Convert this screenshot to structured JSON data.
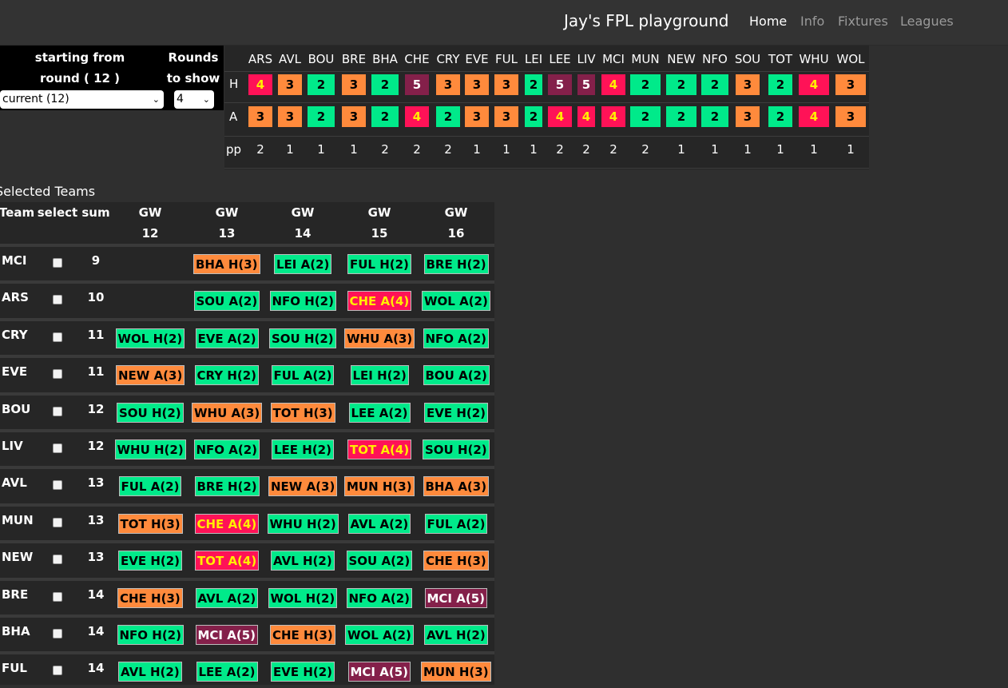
{
  "nav": {
    "brand": "Jay's FPL playground",
    "links": [
      "Home",
      "Info",
      "Fixtures",
      "Leagues"
    ]
  },
  "controls": {
    "start_label_line1": "starting from",
    "start_label_line2": "round ( 12 )",
    "rounds_label_line1": "Rounds",
    "rounds_label_line2": "to show",
    "round_select_value": "current (12)",
    "show_select_value": "4"
  },
  "difficulty": {
    "teams": [
      "ARS",
      "AVL",
      "BOU",
      "BRE",
      "BHA",
      "CHE",
      "CRY",
      "EVE",
      "FUL",
      "LEI",
      "LEE",
      "LIV",
      "MCI",
      "MUN",
      "NEW",
      "NFO",
      "SOU",
      "TOT",
      "WHU",
      "WOL"
    ],
    "home_label": "H",
    "away_label": "A",
    "pp_label": "pp",
    "home": [
      4,
      3,
      2,
      3,
      2,
      5,
      3,
      3,
      3,
      2,
      5,
      5,
      4,
      2,
      2,
      2,
      3,
      2,
      4,
      3
    ],
    "away": [
      3,
      3,
      2,
      3,
      2,
      4,
      2,
      3,
      3,
      2,
      4,
      4,
      4,
      2,
      2,
      2,
      3,
      2,
      4,
      3
    ],
    "pp": [
      2,
      1,
      1,
      1,
      2,
      2,
      2,
      1,
      1,
      1,
      2,
      2,
      2,
      2,
      1,
      1,
      1,
      1,
      1,
      1
    ]
  },
  "selected": {
    "title": "Selected Teams",
    "headers": {
      "team": "Team",
      "select": "select",
      "sum": "sum",
      "gw_word": "GW",
      "gws": [
        "12",
        "13",
        "14",
        "15",
        "16"
      ]
    },
    "rows": [
      {
        "team": "MCI",
        "sum": "9",
        "fixtures": [
          null,
          {
            "t": "BHA H(3)",
            "d": 3
          },
          {
            "t": "LEI A(2)",
            "d": 2
          },
          {
            "t": "FUL H(2)",
            "d": 2
          },
          {
            "t": "BRE H(2)",
            "d": 2
          }
        ]
      },
      {
        "team": "ARS",
        "sum": "10",
        "fixtures": [
          null,
          {
            "t": "SOU A(2)",
            "d": 2
          },
          {
            "t": "NFO H(2)",
            "d": 2
          },
          {
            "t": "CHE A(4)",
            "d": 4
          },
          {
            "t": "WOL A(2)",
            "d": 2
          }
        ]
      },
      {
        "team": "CRY",
        "sum": "11",
        "fixtures": [
          {
            "t": "WOL H(2)",
            "d": 2
          },
          {
            "t": "EVE A(2)",
            "d": 2
          },
          {
            "t": "SOU H(2)",
            "d": 2
          },
          {
            "t": "WHU A(3)",
            "d": 3
          },
          {
            "t": "NFO A(2)",
            "d": 2
          }
        ]
      },
      {
        "team": "EVE",
        "sum": "11",
        "fixtures": [
          {
            "t": "NEW A(3)",
            "d": 3
          },
          {
            "t": "CRY H(2)",
            "d": 2
          },
          {
            "t": "FUL A(2)",
            "d": 2
          },
          {
            "t": "LEI H(2)",
            "d": 2
          },
          {
            "t": "BOU A(2)",
            "d": 2
          }
        ]
      },
      {
        "team": "BOU",
        "sum": "12",
        "fixtures": [
          {
            "t": "SOU H(2)",
            "d": 2
          },
          {
            "t": "WHU A(3)",
            "d": 3
          },
          {
            "t": "TOT H(3)",
            "d": 3
          },
          {
            "t": "LEE A(2)",
            "d": 2
          },
          {
            "t": "EVE H(2)",
            "d": 2
          }
        ]
      },
      {
        "team": "LIV",
        "sum": "12",
        "fixtures": [
          {
            "t": "WHU H(2)",
            "d": 2
          },
          {
            "t": "NFO A(2)",
            "d": 2
          },
          {
            "t": "LEE H(2)",
            "d": 2
          },
          {
            "t": "TOT A(4)",
            "d": 4
          },
          {
            "t": "SOU H(2)",
            "d": 2
          }
        ]
      },
      {
        "team": "AVL",
        "sum": "13",
        "fixtures": [
          {
            "t": "FUL A(2)",
            "d": 2
          },
          {
            "t": "BRE H(2)",
            "d": 2
          },
          {
            "t": "NEW A(3)",
            "d": 3
          },
          {
            "t": "MUN H(3)",
            "d": 3
          },
          {
            "t": "BHA A(3)",
            "d": 3
          }
        ]
      },
      {
        "team": "MUN",
        "sum": "13",
        "fixtures": [
          {
            "t": "TOT H(3)",
            "d": 3
          },
          {
            "t": "CHE A(4)",
            "d": 4
          },
          {
            "t": "WHU H(2)",
            "d": 2
          },
          {
            "t": "AVL A(2)",
            "d": 2
          },
          {
            "t": "FUL A(2)",
            "d": 2
          }
        ]
      },
      {
        "team": "NEW",
        "sum": "13",
        "fixtures": [
          {
            "t": "EVE H(2)",
            "d": 2
          },
          {
            "t": "TOT A(4)",
            "d": 4
          },
          {
            "t": "AVL H(2)",
            "d": 2
          },
          {
            "t": "SOU A(2)",
            "d": 2
          },
          {
            "t": "CHE H(3)",
            "d": 3
          }
        ]
      },
      {
        "team": "BRE",
        "sum": "14",
        "fixtures": [
          {
            "t": "CHE H(3)",
            "d": 3
          },
          {
            "t": "AVL A(2)",
            "d": 2
          },
          {
            "t": "WOL H(2)",
            "d": 2
          },
          {
            "t": "NFO A(2)",
            "d": 2
          },
          {
            "t": "MCI A(5)",
            "d": 5
          }
        ]
      },
      {
        "team": "BHA",
        "sum": "14",
        "fixtures": [
          {
            "t": "NFO H(2)",
            "d": 2
          },
          {
            "t": "MCI A(5)",
            "d": 5
          },
          {
            "t": "CHE H(3)",
            "d": 3
          },
          {
            "t": "WOL A(2)",
            "d": 2
          },
          {
            "t": "AVL H(2)",
            "d": 2
          }
        ]
      },
      {
        "team": "FUL",
        "sum": "14",
        "fixtures": [
          {
            "t": "AVL H(2)",
            "d": 2
          },
          {
            "t": "LEE A(2)",
            "d": 2
          },
          {
            "t": "EVE H(2)",
            "d": 2
          },
          {
            "t": "MCI A(5)",
            "d": 5
          },
          {
            "t": "MUN H(3)",
            "d": 3
          }
        ]
      }
    ]
  },
  "colors": {
    "diff2": "#00ea8a",
    "diff3": "#ff8a3c",
    "diff4": "#ff1257",
    "diff5": "#84204a"
  }
}
